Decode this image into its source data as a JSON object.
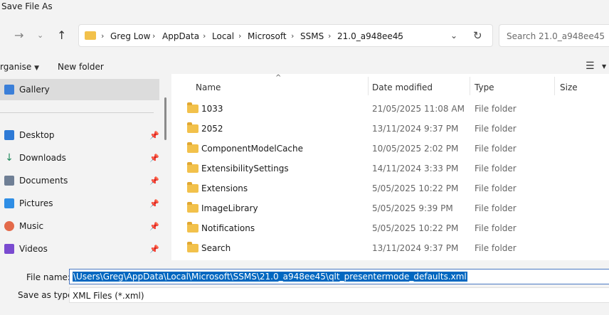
{
  "window": {
    "title": "Save File As"
  },
  "address": {
    "crumbs": [
      "Greg Low",
      "AppData",
      "Local",
      "Microsoft",
      "SSMS",
      "21.0_a948ee45"
    ]
  },
  "search": {
    "placeholder": "Search 21.0_a948ee45"
  },
  "toolbar": {
    "organise": "rganise",
    "new_folder": "New folder"
  },
  "sidebar": {
    "items": [
      {
        "label": "Gallery",
        "icon": "gallery-icon"
      },
      {
        "label": "Desktop",
        "icon": "desktop-icon"
      },
      {
        "label": "Downloads",
        "icon": "download-icon"
      },
      {
        "label": "Documents",
        "icon": "documents-icon"
      },
      {
        "label": "Pictures",
        "icon": "pictures-icon"
      },
      {
        "label": "Music",
        "icon": "music-icon"
      },
      {
        "label": "Videos",
        "icon": "videos-icon"
      }
    ]
  },
  "columns": {
    "name": "Name",
    "date": "Date modified",
    "type": "Type",
    "size": "Size"
  },
  "files": [
    {
      "name": "1033",
      "date": "21/05/2025 11:08 AM",
      "type": "File folder"
    },
    {
      "name": "2052",
      "date": "13/11/2024 9:37 PM",
      "type": "File folder"
    },
    {
      "name": "ComponentModelCache",
      "date": "10/05/2025 2:02 PM",
      "type": "File folder"
    },
    {
      "name": "ExtensibilitySettings",
      "date": "14/11/2024 3:33 PM",
      "type": "File folder"
    },
    {
      "name": "Extensions",
      "date": "5/05/2025 10:22 PM",
      "type": "File folder"
    },
    {
      "name": "ImageLibrary",
      "date": "5/05/2025 9:39 PM",
      "type": "File folder"
    },
    {
      "name": "Notifications",
      "date": "5/05/2025 10:22 PM",
      "type": "File folder"
    },
    {
      "name": "Search",
      "date": "13/11/2024 9:37 PM",
      "type": "File folder"
    }
  ],
  "form": {
    "file_name_label": "File name:",
    "file_name_value": "\\Users\\Greg\\AppData\\Local\\Microsoft\\SSMS\\21.0_a948ee45\\qlt_presentermode_defaults.xml",
    "save_type_label": "Save as type:",
    "save_type_value": "XML Files (*.xml)"
  },
  "colors": {
    "folder": "#f2c14b",
    "selection": "#0067c0",
    "accent_border": "#4a78c2"
  }
}
